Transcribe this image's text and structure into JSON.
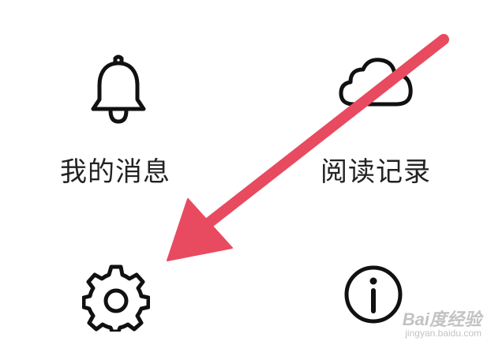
{
  "menu": {
    "items": [
      {
        "label": "我的消息",
        "icon": "bell-icon"
      },
      {
        "label": "阅读记录",
        "icon": "cloud-icon"
      },
      {
        "label": "",
        "icon": "gear-icon"
      },
      {
        "label": "",
        "icon": "info-icon"
      }
    ]
  },
  "annotation": {
    "color": "#e84a5f",
    "points_to": "gear-icon"
  },
  "watermark": {
    "main": "Bai度经验",
    "sub": "jingyan.baidu.com"
  }
}
